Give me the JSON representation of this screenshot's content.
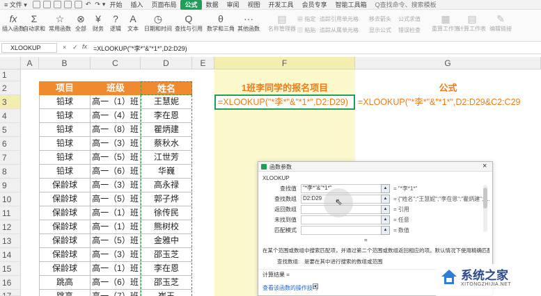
{
  "menubar": {
    "file_menu": "文件",
    "tabs": [
      "开始",
      "插入",
      "页面布局",
      "公式",
      "数据",
      "审阅",
      "视图",
      "开发工具",
      "会员专享",
      "智能工具箱"
    ],
    "active_tab": "公式",
    "search_placeholder": "Q查找命令、搜索模板"
  },
  "ribbon": {
    "buttons": [
      {
        "label": "插入函数",
        "icon": "fx"
      },
      {
        "label": "自动求和",
        "icon": "Σ"
      },
      {
        "label": "常用函数",
        "icon": "☆"
      },
      {
        "label": "全部",
        "icon": "⊗"
      },
      {
        "label": "财务",
        "icon": "¥"
      },
      {
        "label": "逻辑",
        "icon": "?"
      },
      {
        "label": "文本",
        "icon": "A"
      },
      {
        "label": "日期和时间",
        "icon": "◷"
      },
      {
        "label": "查找与引用",
        "icon": "Q"
      },
      {
        "label": "数学和三角",
        "icon": "θ"
      },
      {
        "label": "其他函数",
        "icon": "···"
      },
      {
        "label": "名称管理器",
        "icon": "▤"
      },
      {
        "label": "指定",
        "icon": "▦"
      },
      {
        "label": "粘贴",
        "icon": "▥"
      }
    ],
    "group2": [
      "追踪引用单元格",
      "移去箭头",
      "公式求值",
      "追踪从属单元格",
      "显示公式",
      "错误检查"
    ],
    "right_buttons": [
      {
        "label": "重算工作簿",
        "icon": "▦"
      },
      {
        "label": "计算工作表",
        "icon": "▤"
      },
      {
        "label": "编辑链接",
        "icon": "✎"
      }
    ]
  },
  "formula_bar": {
    "name_box": "XLOOKUP",
    "cancel": "×",
    "confirm": "✓",
    "fx": "fx",
    "formula": "=XLOOKUP(\"*李*\"&\"*1*\",D2:D29)"
  },
  "columns": [
    "A",
    "B",
    "C",
    "D",
    "E",
    "F",
    "G"
  ],
  "rows": [
    "1",
    "2",
    "3",
    "4",
    "5",
    "6",
    "7",
    "8",
    "9",
    "10",
    "11",
    "12",
    "13",
    "14",
    "15",
    "16",
    "17"
  ],
  "table": {
    "headers": [
      "项目",
      "班级",
      "姓名"
    ],
    "rows": [
      [
        "铅球",
        "高一（1）班",
        "王慧妮"
      ],
      [
        "铅球",
        "高一（4）班",
        "李在恩"
      ],
      [
        "铅球",
        "高一（8）班",
        "瞿炳建"
      ],
      [
        "铅球",
        "高一（3）班",
        "蔡秋水"
      ],
      [
        "铅球",
        "高一（5）班",
        "江世芳"
      ],
      [
        "铅球",
        "高一（6）班",
        "华巍"
      ],
      [
        "保龄球",
        "高一（3）班",
        "高永禄"
      ],
      [
        "保龄球",
        "高一（5）班",
        "郭子烨"
      ],
      [
        "保龄球",
        "高一（1）班",
        "徐传民"
      ],
      [
        "保龄球",
        "高一（1）班",
        "熊树校"
      ],
      [
        "保龄球",
        "高一（5）班",
        "金雅中"
      ],
      [
        "保龄球",
        "高一（3）班",
        "邵玉芝"
      ],
      [
        "保龄球",
        "高一（1）班",
        "李在恩"
      ],
      [
        "跳高",
        "高一（6）班",
        "邵玉芝"
      ],
      [
        "跳高",
        "高一（7）班",
        "崔玉"
      ]
    ]
  },
  "f_column": {
    "header": "1班李同学的报名项目",
    "formula": "=XLOOKUP(\"*李*\"&\"*1*\",D2:D29)"
  },
  "g_column": {
    "header": "公式",
    "formula": "=XLOOKUP(\"*李*\"&\"*1*\",D2:D29&C2:C29"
  },
  "dialog": {
    "title": "函数参数",
    "function_name": "XLOOKUP",
    "close": "×",
    "fields": [
      {
        "label": "查找值",
        "value": "\"*李*\"&\"*1*\"",
        "result": "= \"*李*1*\""
      },
      {
        "label": "查找数组",
        "value": "D2:D29",
        "result": "= {\"姓名\";\"王慧妮\";\"李在恩\";\"瞿炳建\";\"..."
      },
      {
        "label": "返回数组",
        "value": "",
        "result": "= 引用"
      },
      {
        "label": "未找到值",
        "value": "",
        "result": "= 任意"
      },
      {
        "label": "匹配模式",
        "value": "",
        "result": "= 数值"
      }
    ],
    "equals": "=",
    "description": "在某个范围或数组中搜索匹配项，并通过第二个范围或数组返回相应的项。默认情况下使用精确匹配",
    "param_desc_label": "查找数组:",
    "param_desc": "是要在其中进行搜索的数组或范围",
    "calc_result": "计算结果 =",
    "help_link": "查看该函数的操作技巧"
  },
  "watermark": {
    "brand": "系统之家",
    "url": "XITONGZHIJIA.NET"
  },
  "colors": {
    "accent_green": "#1f9e5a",
    "header_orange": "#f08a2e",
    "selected_col": "#fbf8cc",
    "formula_text": "#ef7b16"
  }
}
